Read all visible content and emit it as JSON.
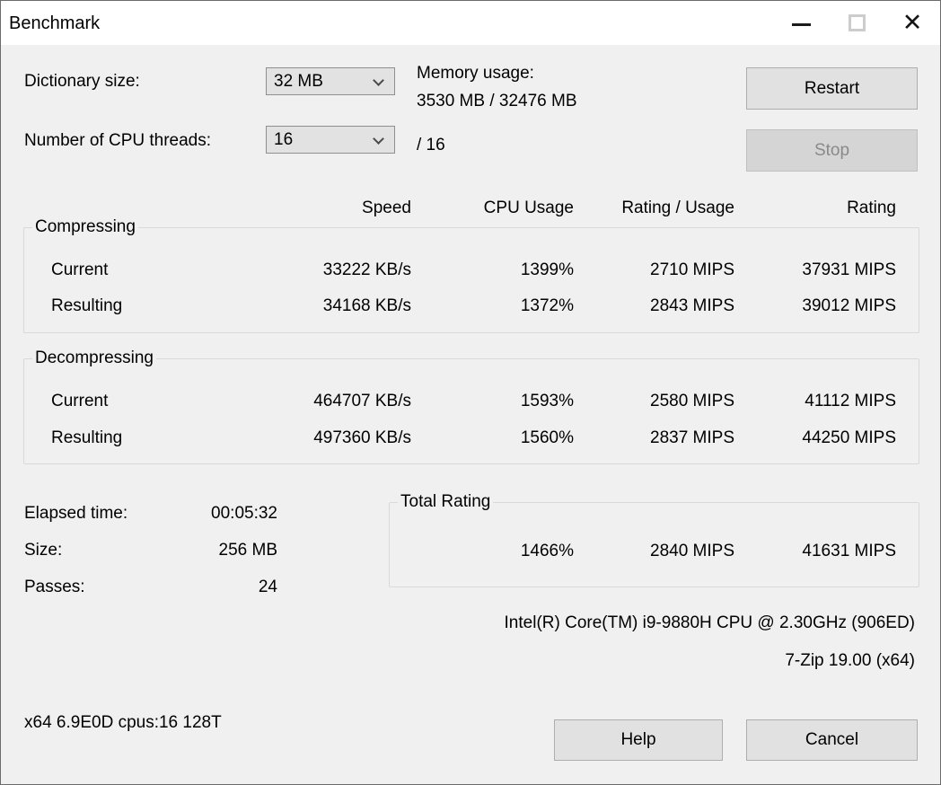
{
  "window": {
    "title": "Benchmark"
  },
  "settings": {
    "dictionary_label": "Dictionary size:",
    "dictionary_value": "32 MB",
    "memory_label": "Memory usage:",
    "memory_value": "3530 MB / 32476 MB",
    "threads_label": "Number of CPU threads:",
    "threads_value": "16",
    "threads_suffix": "/ 16"
  },
  "buttons": {
    "restart": "Restart",
    "stop": "Stop",
    "help": "Help",
    "cancel": "Cancel"
  },
  "table": {
    "headers": {
      "speed": "Speed",
      "cpu_usage": "CPU Usage",
      "rating_usage": "Rating / Usage",
      "rating": "Rating"
    },
    "compressing": {
      "title": "Compressing",
      "current": {
        "label": "Current",
        "speed": "33222 KB/s",
        "cpu_usage": "1399%",
        "rating_usage": "2710 MIPS",
        "rating": "37931 MIPS"
      },
      "resulting": {
        "label": "Resulting",
        "speed": "34168 KB/s",
        "cpu_usage": "1372%",
        "rating_usage": "2843 MIPS",
        "rating": "39012 MIPS"
      }
    },
    "decompressing": {
      "title": "Decompressing",
      "current": {
        "label": "Current",
        "speed": "464707 KB/s",
        "cpu_usage": "1593%",
        "rating_usage": "2580 MIPS",
        "rating": "41112 MIPS"
      },
      "resulting": {
        "label": "Resulting",
        "speed": "497360 KB/s",
        "cpu_usage": "1560%",
        "rating_usage": "2837 MIPS",
        "rating": "44250 MIPS"
      }
    }
  },
  "stats": {
    "elapsed_label": "Elapsed time:",
    "elapsed_value": "00:05:32",
    "size_label": "Size:",
    "size_value": "256 MB",
    "passes_label": "Passes:",
    "passes_value": "24"
  },
  "total_rating": {
    "title": "Total Rating",
    "cpu_usage": "1466%",
    "rating_usage": "2840 MIPS",
    "rating": "41631 MIPS"
  },
  "footer": {
    "cpu_info": "Intel(R) Core(TM) i9-9880H CPU @ 2.30GHz (906ED)",
    "version": "7-Zip 19.00 (x64)",
    "build_info": "x64 6.9E0D cpus:16 128T"
  },
  "colors": {
    "dialog_bg": "#f0f0f0",
    "titlebar_bg": "#ffffff",
    "button_bg": "#e1e1e1",
    "button_border": "#adadad",
    "disabled_text": "#8a8a8a",
    "groupbox_border": "#d9d9d9",
    "window_border": "#6b6b6b"
  }
}
